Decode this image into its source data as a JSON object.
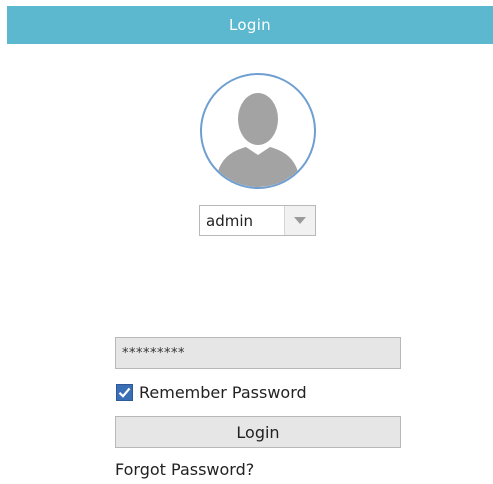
{
  "window": {
    "title": "Login"
  },
  "avatar": {
    "icon": "user-silhouette-icon"
  },
  "user_select": {
    "selected": "admin",
    "icon": "triangle-down-icon"
  },
  "password": {
    "masked_value": "*********"
  },
  "remember": {
    "checked": true,
    "label": "Remember Password"
  },
  "login_button": {
    "label": "Login"
  },
  "forgot_link": {
    "label": "Forgot Password?"
  },
  "colors": {
    "titlebar": "#5bb8cf",
    "avatar_border": "#6e9fd0",
    "checkbox": "#3a6fb6"
  }
}
